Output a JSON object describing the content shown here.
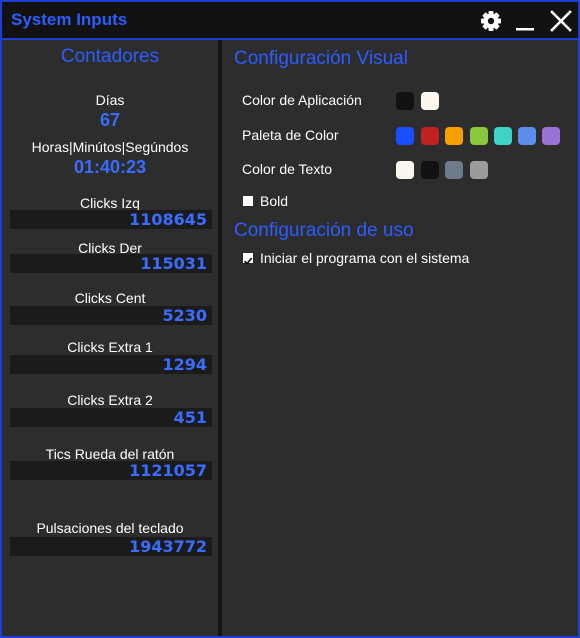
{
  "window": {
    "title": "System Inputs",
    "accent_color": "#1e3fd6",
    "title_color": "#2b5dff",
    "buttons": [
      "gear-icon",
      "minimize-icon",
      "close-icon"
    ]
  },
  "counters": {
    "title": "Contadores",
    "days": {
      "label": "Días",
      "value": "67"
    },
    "time": {
      "label": "Horas|Minútos|Segúndos",
      "value": "01:40:23"
    },
    "items": [
      {
        "label": "Clicks Izq",
        "value": "1108645"
      },
      {
        "label": "Clicks Der",
        "value": "115031"
      },
      {
        "label": "Clicks Cent",
        "value": "5230"
      },
      {
        "label": "Clicks Extra 1",
        "value": "1294"
      },
      {
        "label": "Clicks Extra 2",
        "value": "451"
      },
      {
        "label": "Tics Rueda del ratón",
        "value": "1121057"
      },
      {
        "label": "Pulsaciones del teclado",
        "value": "1943772"
      }
    ]
  },
  "visual": {
    "title": "Configuración Visual",
    "app_color": {
      "label": "Color de Aplicación",
      "colors": [
        "#121212",
        "#fbf7ef"
      ]
    },
    "palette": {
      "label": "Paleta de Color",
      "colors": [
        "#1a4fff",
        "#c02121",
        "#f4a100",
        "#8cc63f",
        "#3fd3c5",
        "#5b8ee9",
        "#9b71d6"
      ]
    },
    "text_color": {
      "label": "Color de Texto",
      "colors": [
        "#fbf7ef",
        "#121212",
        "#6c7a8b",
        "#9b9b9b"
      ]
    },
    "bold": {
      "label": "Bold",
      "checked": false
    }
  },
  "usage": {
    "title": "Configuración de uso",
    "startup": {
      "label": "Iniciar el programa con el sistema",
      "checked": true
    }
  }
}
